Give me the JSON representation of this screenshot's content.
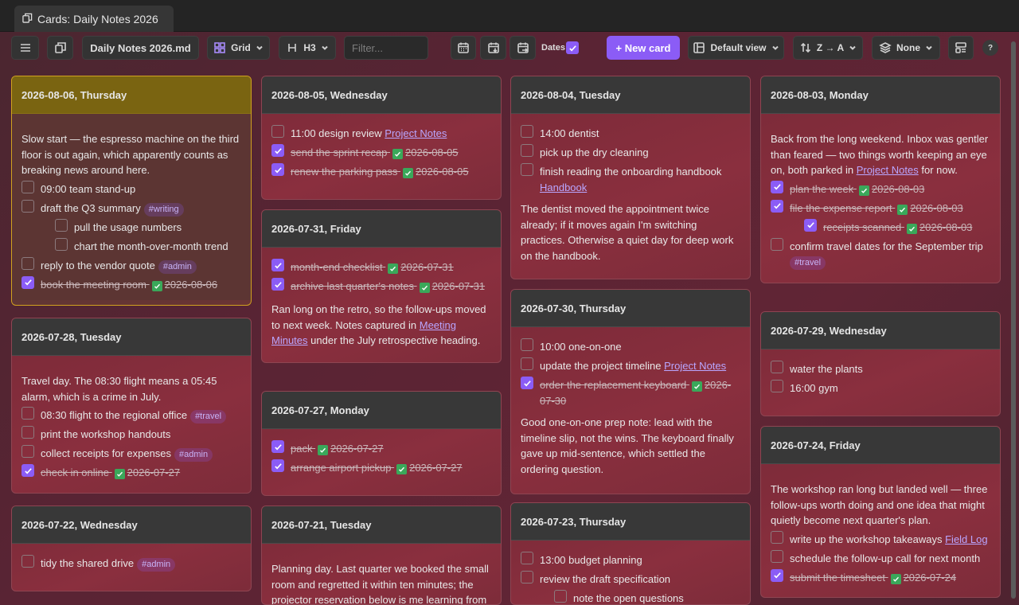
{
  "tab": {
    "title": "Cards: Daily Notes 2026"
  },
  "toolbar": {
    "file": "Daily Notes 2026.md",
    "view_mode": "Grid",
    "heading": "H3",
    "filter_placeholder": "Filter...",
    "dates_label": "Dates",
    "new_card": "+ New card",
    "view": "Default view",
    "sort": "Z → A",
    "group": "None",
    "help": "?"
  },
  "colors": {
    "accent": "#8b5cf6",
    "active_border": "#d1a21f",
    "done_tick": "#3aa85a"
  },
  "cards": [
    {
      "title": "2026-08-06, Thursday",
      "items": [
        {
          "type": "para",
          "text": "Slow start — the espresso machine on the third floor is out again, which apparently counts as breaking news around here."
        },
        {
          "type": "task",
          "text": "09:00 team stand-up"
        },
        {
          "type": "task",
          "text": "draft the Q3 summary",
          "tag": "#writing"
        },
        {
          "type": "task",
          "sub": true,
          "text": "pull the usage numbers"
        },
        {
          "type": "task",
          "sub": true,
          "text": "chart the month-over-month trend"
        },
        {
          "type": "task",
          "text": "reply to the vendor quote",
          "tag": "#admin"
        },
        {
          "type": "task",
          "done": true,
          "text": "book the meeting room",
          "date": "2026-08-06"
        }
      ]
    },
    {
      "title": "2026-07-28, Tuesday",
      "items": [
        {
          "type": "para",
          "text": "Travel day. The 08:30 flight means a 05:45 alarm, which is a crime in July."
        },
        {
          "type": "task",
          "text": "08:30 flight to the regional office",
          "tag": "#travel"
        },
        {
          "type": "task",
          "text": "print the workshop handouts"
        },
        {
          "type": "task",
          "text": "collect receipts for expenses",
          "tag": "#admin"
        },
        {
          "type": "task",
          "done": true,
          "text": "check in online",
          "date": "2026-07-27"
        }
      ]
    },
    {
      "title": "2026-07-22, Wednesday",
      "items": [
        {
          "type": "task",
          "text": "tidy the shared drive",
          "tag": "#admin"
        }
      ]
    },
    {
      "title": "2026-08-05, Wednesday",
      "items": [
        {
          "type": "task",
          "text": "11:00 design review",
          "link": "Project Notes"
        },
        {
          "type": "task",
          "done": true,
          "text": "send the sprint recap",
          "date": "2026-08-05"
        },
        {
          "type": "task",
          "done": true,
          "text": "renew the parking pass",
          "date": "2026-08-05"
        }
      ]
    },
    {
      "title": "2026-07-31, Friday",
      "items": [
        {
          "type": "task",
          "done": true,
          "text": "month-end checklist",
          "date": "2026-07-31"
        },
        {
          "type": "task",
          "done": true,
          "text": "archive last quarter's notes",
          "date": "2026-07-31"
        },
        {
          "type": "para",
          "text": "Ran long on the retro, so the follow-ups moved to next week. Notes captured in",
          "link": "Meeting Minutes",
          "after": "under the July retrospective heading."
        }
      ]
    },
    {
      "title": "2026-07-27, Monday",
      "items": [
        {
          "type": "task",
          "done": true,
          "text": "pack",
          "date": "2026-07-27"
        },
        {
          "type": "task",
          "done": true,
          "text": "arrange airport pickup",
          "date": "2026-07-27"
        }
      ]
    },
    {
      "title": "2026-07-21, Tuesday",
      "items": [
        {
          "type": "para",
          "text": "Planning day. Last quarter we booked the small room and regretted it within ten minutes; the projector reservation below is me learning from"
        }
      ]
    },
    {
      "title": "2026-08-04, Tuesday",
      "items": [
        {
          "type": "task",
          "text": "14:00 dentist"
        },
        {
          "type": "task",
          "text": "pick up the dry cleaning"
        },
        {
          "type": "task",
          "text": "finish reading the onboarding handbook",
          "link_below": "Handbook"
        },
        {
          "type": "para",
          "text": "The dentist moved the appointment twice already; if it moves again I'm switching practices. Otherwise a quiet day for deep work on the handbook."
        }
      ]
    },
    {
      "title": "2026-07-30, Thursday",
      "items": [
        {
          "type": "task",
          "text": "10:00 one-on-one"
        },
        {
          "type": "task",
          "text": "update the project timeline",
          "link": "Project Notes"
        },
        {
          "type": "task",
          "done": true,
          "text": "order the replacement keyboard",
          "date": "2026-07-30"
        },
        {
          "type": "para",
          "text": "Good one-on-one prep note: lead with the timeline slip, not the wins. The keyboard finally gave up mid-sentence, which settled the ordering question."
        }
      ]
    },
    {
      "title": "2026-07-23, Thursday",
      "items": [
        {
          "type": "task",
          "text": "13:00 budget planning"
        },
        {
          "type": "task",
          "text": "review the draft specification"
        },
        {
          "type": "task",
          "sub": true,
          "text": "note the open questions"
        }
      ]
    },
    {
      "title": "2026-08-03, Monday",
      "items": [
        {
          "type": "para",
          "text": "Back from the long weekend. Inbox was gentler than feared — two things worth keeping an eye on, both parked in",
          "link": "Project Notes",
          "after": "for now."
        },
        {
          "type": "task",
          "done": true,
          "text": "plan the week",
          "date": "2026-08-03"
        },
        {
          "type": "task",
          "done": true,
          "text": "file the expense report",
          "date": "2026-08-03"
        },
        {
          "type": "task",
          "done": true,
          "sub": true,
          "text": "receipts scanned",
          "date": "2026-08-03"
        },
        {
          "type": "task",
          "text": "confirm travel dates for the September trip",
          "tag_below": "#travel"
        }
      ]
    },
    {
      "title": "2026-07-29, Wednesday",
      "items": [
        {
          "type": "task",
          "text": "water the plants"
        },
        {
          "type": "task",
          "text": "16:00 gym"
        }
      ]
    },
    {
      "title": "2026-07-24, Friday",
      "items": [
        {
          "type": "para",
          "text": "The workshop ran long but landed well — three follow-ups worth doing and one idea that might quietly become next quarter's plan."
        },
        {
          "type": "task",
          "text": "write up the workshop takeaways",
          "link": "Field Log"
        },
        {
          "type": "task",
          "text": "schedule the follow-up call for next month"
        },
        {
          "type": "task",
          "done": true,
          "text": "submit the timesheet",
          "date": "2026-07-24"
        }
      ]
    }
  ]
}
